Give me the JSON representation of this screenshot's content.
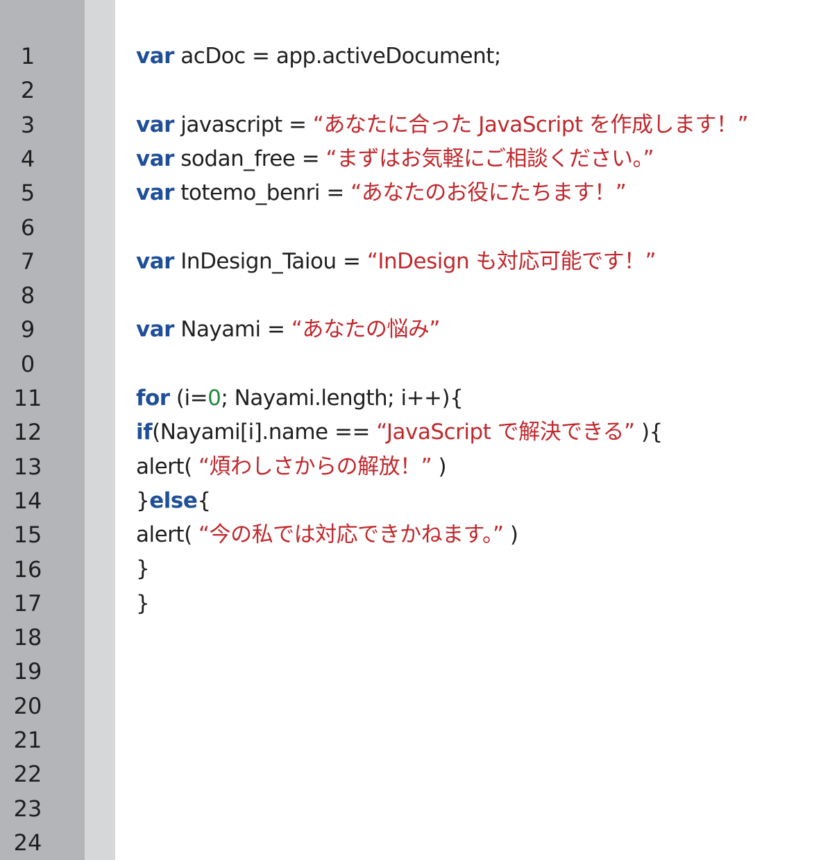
{
  "editor": {
    "line_numbers": [
      "1",
      "2",
      "3",
      "4",
      "5",
      "6",
      "7",
      "8",
      "9",
      "0",
      "11",
      "12",
      "13",
      "14",
      "15",
      "16",
      "17",
      "18",
      "19",
      "20",
      "21",
      "22",
      "23",
      "24"
    ],
    "colors": {
      "gutter": "#b4b5b8",
      "gutter_strip": "#d6d7d9",
      "keyword": "#1f4f98",
      "string": "#c0282d",
      "number": "#1f8a3c",
      "text": "#1e1e1e"
    },
    "lines": [
      [
        {
          "t": "kw",
          "v": "var"
        },
        {
          "t": "plain",
          "v": " acDoc = app.activeDocument;"
        }
      ],
      [],
      [
        {
          "t": "kw",
          "v": "var"
        },
        {
          "t": "plain",
          "v": " javascript = "
        },
        {
          "t": "str",
          "v": "“あなたに合った JavaScript を作成します！”"
        }
      ],
      [
        {
          "t": "kw",
          "v": "var"
        },
        {
          "t": "plain",
          "v": " sodan_free = "
        },
        {
          "t": "str",
          "v": "“まずはお気軽にご相談ください。”"
        }
      ],
      [
        {
          "t": "kw",
          "v": "var"
        },
        {
          "t": "plain",
          "v": " totemo_benri = "
        },
        {
          "t": "str",
          "v": "“あなたのお役にたちます！”"
        }
      ],
      [],
      [
        {
          "t": "kw",
          "v": "var"
        },
        {
          "t": "plain",
          "v": " InDesign_Taiou = "
        },
        {
          "t": "str",
          "v": "“InDesign も対応可能です！”"
        }
      ],
      [],
      [
        {
          "t": "kw",
          "v": "var"
        },
        {
          "t": "plain",
          "v": " Nayami = "
        },
        {
          "t": "str",
          "v": "“あなたの悩み”"
        }
      ],
      [],
      [
        {
          "t": "kw",
          "v": "for"
        },
        {
          "t": "plain",
          "v": " (i="
        },
        {
          "t": "num",
          "v": "0"
        },
        {
          "t": "plain",
          "v": "; Nayami.length; i++){"
        }
      ],
      [
        {
          "t": "kw",
          "v": "if"
        },
        {
          "t": "plain",
          "v": "(Nayami[i].name == "
        },
        {
          "t": "str",
          "v": "“JavaScript で解決できる”"
        },
        {
          "t": "plain",
          "v": " ){"
        }
      ],
      [
        {
          "t": "plain",
          "v": "alert( "
        },
        {
          "t": "str",
          "v": "“煩わしさからの解放！”"
        },
        {
          "t": "plain",
          "v": " )"
        }
      ],
      [
        {
          "t": "plain",
          "v": "}"
        },
        {
          "t": "kw",
          "v": "else"
        },
        {
          "t": "plain",
          "v": "{"
        }
      ],
      [
        {
          "t": "plain",
          "v": "alert( "
        },
        {
          "t": "str",
          "v": "“今の私では対応できかねます。”"
        },
        {
          "t": "plain",
          "v": " )"
        }
      ],
      [
        {
          "t": "plain",
          "v": "}"
        }
      ],
      [
        {
          "t": "plain",
          "v": "}"
        }
      ],
      [],
      [],
      [],
      [],
      [],
      [],
      []
    ]
  }
}
